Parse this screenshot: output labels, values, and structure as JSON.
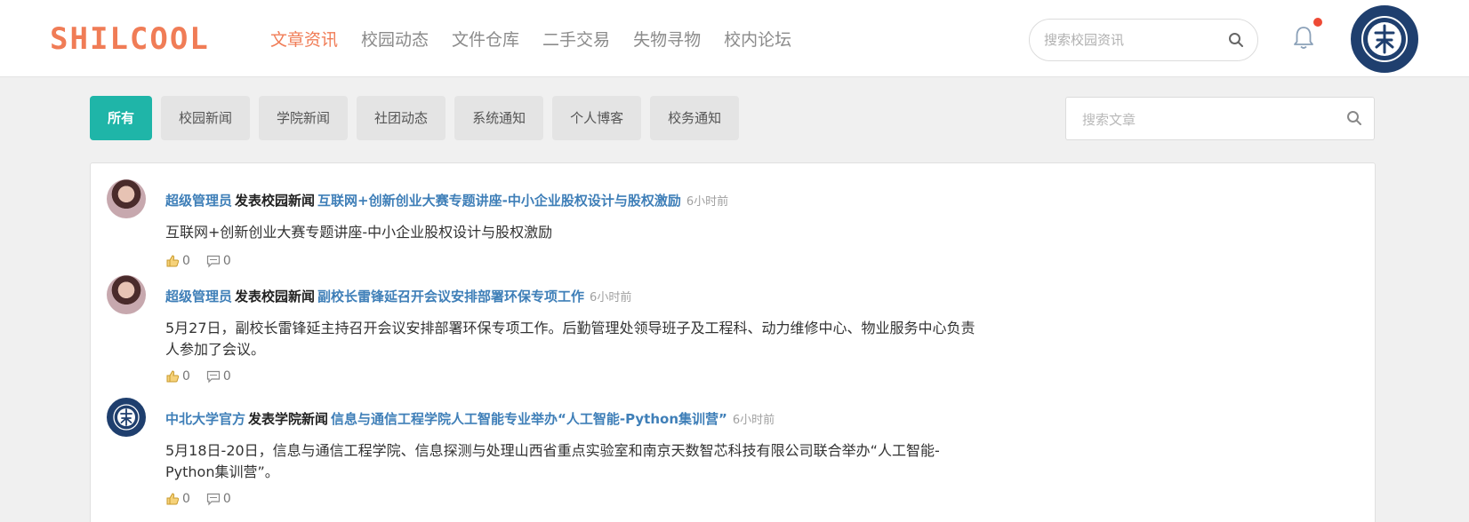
{
  "header": {
    "logo": "SHILCOOL",
    "nav": [
      {
        "label": "文章资讯",
        "active": true
      },
      {
        "label": "校园动态",
        "active": false
      },
      {
        "label": "文件仓库",
        "active": false
      },
      {
        "label": "二手交易",
        "active": false
      },
      {
        "label": "失物寻物",
        "active": false
      },
      {
        "label": "校内论坛",
        "active": false
      }
    ],
    "search_placeholder": "搜索校园资讯",
    "notification_dot": true,
    "avatar": "school-emblem"
  },
  "categories": [
    {
      "label": "所有",
      "active": true
    },
    {
      "label": "校园新闻",
      "active": false
    },
    {
      "label": "学院新闻",
      "active": false
    },
    {
      "label": "社团动态",
      "active": false
    },
    {
      "label": "系统通知",
      "active": false
    },
    {
      "label": "个人博客",
      "active": false
    },
    {
      "label": "校务通知",
      "active": false
    }
  ],
  "article_search_placeholder": "搜索文章",
  "posts": [
    {
      "author": "超级管理员",
      "verb": "发表校园新闻",
      "title": "互联网+创新创业大赛专题讲座-中小企业股权设计与股权激励",
      "time": "6小时前",
      "body": "互联网+创新创业大赛专题讲座-中小企业股权设计与股权激励",
      "likes": "0",
      "comments": "0",
      "avatar": "person-photo"
    },
    {
      "author": "超级管理员",
      "verb": "发表校园新闻",
      "title": "副校长雷锋延召开会议安排部署环保专项工作",
      "time": "6小时前",
      "body": "5月27日，副校长雷锋延主持召开会议安排部署环保专项工作。后勤管理处领导班子及工程科、动力维修中心、物业服务中心负责人参加了会议。",
      "likes": "0",
      "comments": "0",
      "avatar": "person-photo"
    },
    {
      "author": "中北大学官方",
      "verb": "发表学院新闻",
      "title": "信息与通信工程学院人工智能专业举办“人工智能-Python集训营”",
      "time": "6小时前",
      "body": "5月18日-20日，信息与通信工程学院、信息探测与处理山西省重点实验室和南京天数智芯科技有限公司联合举办“人工智能-Python集训营”。",
      "likes": "0",
      "comments": "0",
      "avatar": "school-emblem"
    }
  ],
  "colors": {
    "accent": "#f07c56",
    "teal": "#1fb5a8",
    "link": "#3f7fb8",
    "navy": "#1f3f6e",
    "badge": "#ee4a35"
  }
}
